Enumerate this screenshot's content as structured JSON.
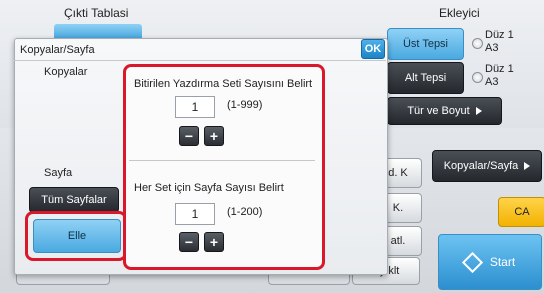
{
  "header": {
    "output_tray_label": "Çıkti Tablasi",
    "inserter_label": "Ekleyici"
  },
  "trays": {
    "top_tray": "Üst Tepsi",
    "bottom_tray": "Alt Tepsi",
    "top_paper": "Düz 1",
    "top_size": "A3",
    "bottom_paper": "Düz 1",
    "bottom_size": "A3",
    "type_size_button": "Tür ve Boyut"
  },
  "right_panel": {
    "copies_per_set_button": "Kopyalar/Sayfa",
    "ca_button": "CA",
    "start_button": "Start"
  },
  "partial_buttons": {
    "a": "d. K",
    "b": "K.",
    "c": "atl.",
    "d": "Ayıklt"
  },
  "dialog": {
    "title": "Kopyalar/Sayfa",
    "ok_label": "OK",
    "copies_label": "Kopyalar",
    "page_label": "Sayfa",
    "all_pages_button": "Tüm Sayfalar",
    "manual_button": "Elle",
    "set_count_label": "Bitirilen Yazdırma Seti Sayısını Belirt",
    "set_count_value": "1",
    "set_count_range": "(1-999)",
    "pages_per_set_label": "Her Set için Sayfa Sayısı Belirt",
    "pages_per_set_value": "1",
    "pages_per_set_range": "(1-200)",
    "minus": "−",
    "plus": "+"
  },
  "colors": {
    "highlight": "#d9182b",
    "selected_blue": "#4aa9e0"
  }
}
